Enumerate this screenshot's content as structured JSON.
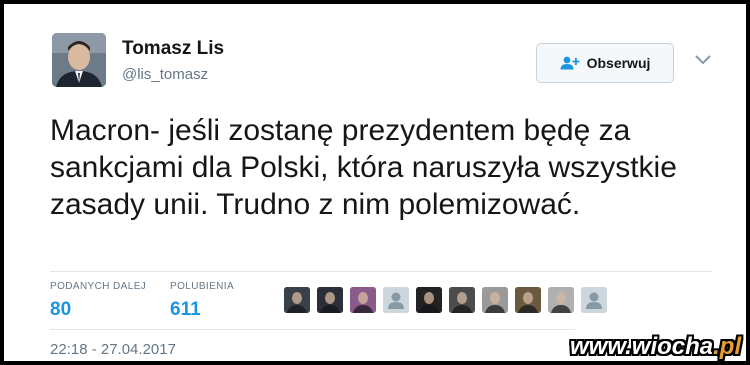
{
  "author": {
    "name": "Tomasz Lis",
    "handle": "@lis_tomasz"
  },
  "follow_button": {
    "label": "Obserwuj",
    "icon": "person-plus-icon"
  },
  "tweet": {
    "text": "Macron- jeśli zostanę prezydentem będę za sankcjami dla Polski, która naruszyła wszystkie zasady unii. Trudno z nim polemizować."
  },
  "stats": {
    "retweets": {
      "label": "PODANYCH DALEJ",
      "value": "80"
    },
    "likes": {
      "label": "POLUBIENIA",
      "value": "611"
    }
  },
  "likers": [
    {
      "icon": "avatar-photo-icon",
      "bg": "#3a4048"
    },
    {
      "icon": "avatar-photo-icon",
      "bg": "#2c2f3a"
    },
    {
      "icon": "avatar-photo-icon",
      "bg": "#8a5a8a"
    },
    {
      "icon": "default-avatar-icon",
      "bg": "#ccd6dd"
    },
    {
      "icon": "avatar-photo-icon",
      "bg": "#222222"
    },
    {
      "icon": "avatar-photo-icon",
      "bg": "#4c4c4c"
    },
    {
      "icon": "avatar-photo-icon",
      "bg": "#9a9a9a"
    },
    {
      "icon": "avatar-photo-icon",
      "bg": "#6a5a40"
    },
    {
      "icon": "avatar-photo-icon",
      "bg": "#b0b0b0"
    },
    {
      "icon": "default-avatar-icon",
      "bg": "#ccd6dd"
    }
  ],
  "timestamp": "22:18 - 27.04.2017",
  "watermark": {
    "main": "www.wiocha",
    "accent": ".pl"
  },
  "colors": {
    "link_blue": "#1b95e0",
    "muted": "#657786",
    "text": "#14171a"
  }
}
